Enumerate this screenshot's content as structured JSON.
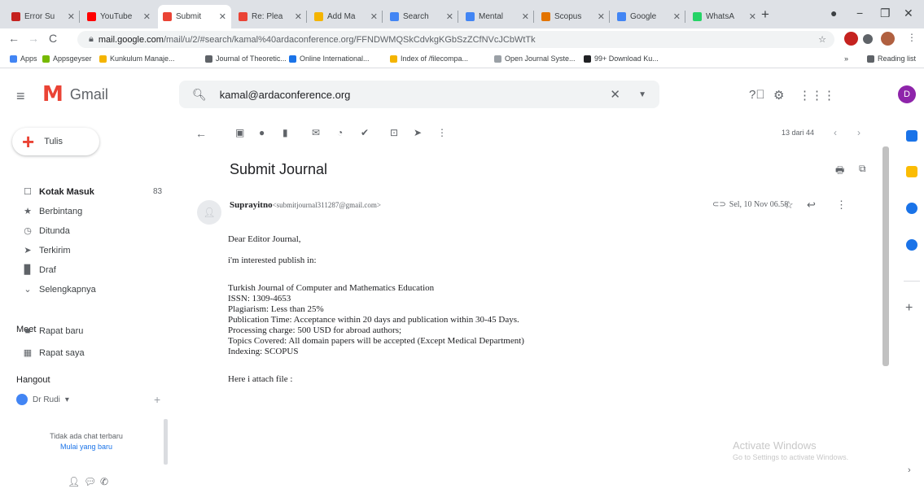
{
  "browser": {
    "tabs": [
      {
        "label": "Error Su",
        "color": "#c5221f"
      },
      {
        "label": "YouTube",
        "color": "#ff0000"
      },
      {
        "label": "Submit",
        "color": "#ea4335",
        "active": true
      },
      {
        "label": "Re: Plea",
        "color": "#ea4335"
      },
      {
        "label": "Add Ma",
        "color": "#f4b400"
      },
      {
        "label": "Search",
        "color": "#4285f4"
      },
      {
        "label": "Mental",
        "color": "#4285f4"
      },
      {
        "label": "Scopus",
        "color": "#e37400"
      },
      {
        "label": "Google",
        "color": "#4285f4"
      },
      {
        "label": "WhatsA",
        "color": "#25d366"
      }
    ],
    "new_tab": "+",
    "url_domain": "mail.google.com",
    "url_path": "/mail/u/2/#search/kamal%40ardaconference.org/FFNDWMQSkCdvkgKGbSzZCfNVcJCbWtTk",
    "bookmarks": [
      {
        "label": "Apps",
        "color": "#4285f4"
      },
      {
        "label": "Appsgeyser",
        "color": "#76b900"
      },
      {
        "label": "Kunkulum Manaje...",
        "color": "#f4b400"
      },
      {
        "label": "Journal of Theoretic...",
        "color": "#5f6368"
      },
      {
        "label": "Online International...",
        "color": "#1a73e8"
      },
      {
        "label": "Index of /filecompa...",
        "color": "#f4b400"
      },
      {
        "label": "Open Journal Syste...",
        "color": "#9aa0a6"
      },
      {
        "label": "99+ Download Ku...",
        "color": "#202124"
      }
    ],
    "more_bookmarks": "»",
    "reading_list": "Reading list"
  },
  "gmail": {
    "logo_text": "Gmail",
    "search_value": "kamal@ardaconference.org",
    "avatar_letter": "D",
    "compose_label": "Tulis",
    "sidebar": [
      {
        "label": "Kotak Masuk",
        "count": "83",
        "icon": "inbox-icon",
        "bold": true
      },
      {
        "label": "Berbintang",
        "count": "",
        "icon": "star-icon"
      },
      {
        "label": "Ditunda",
        "count": "",
        "icon": "clock-icon"
      },
      {
        "label": "Terkirim",
        "count": "",
        "icon": "send-icon"
      },
      {
        "label": "Draf",
        "count": "",
        "icon": "draft-icon"
      },
      {
        "label": "Selengkapnya",
        "count": "",
        "icon": "chevron-down-icon"
      }
    ],
    "meet": {
      "title": "Meet",
      "items": [
        {
          "label": "Rapat baru",
          "icon": "video-icon"
        },
        {
          "label": "Rapat saya",
          "icon": "calendar-icon"
        }
      ]
    },
    "hangout": {
      "title": "Hangout",
      "user": "Dr Rudi",
      "no_chat": "Tidak ada chat terbaru",
      "start_new": "Mulai yang baru"
    },
    "pager": "13 dari 44",
    "message": {
      "subject": "Submit Journal",
      "sender_name": "Suprayitno",
      "sender_email": "<submitjournal311287@gmail.com>",
      "date": "Sel, 10 Nov 06.58",
      "body": [
        "Dear Editor Journal,",
        "i'm interested publish in:",
        "Turkish Journal of Computer and Mathematics Education",
        "ISSN: 1309-4653",
        "Plagiarism: Less than 25%",
        "Publication Time: Acceptance within 20 days and publication within 30-45 Days.",
        "Processing charge: 500 USD for abroad authors;",
        "Topics Covered: All domain papers will be accepted (Except Medical Department)",
        "Indexing: SCOPUS",
        "Here i attach file :"
      ]
    }
  },
  "watermark": {
    "line1": "Activate Windows",
    "line2": "Go to Settings to activate Windows."
  }
}
